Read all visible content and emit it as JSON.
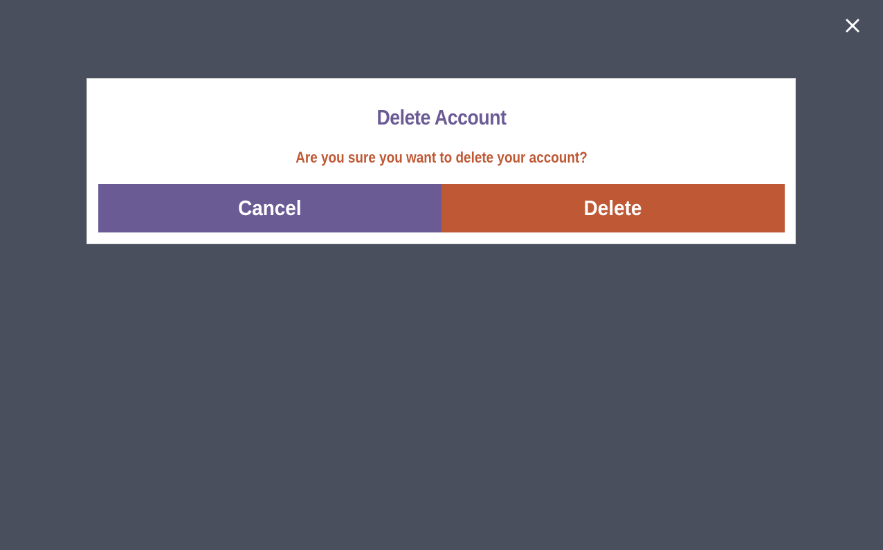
{
  "window": {
    "close_icon": "close-icon"
  },
  "dialog": {
    "title": "Delete Account",
    "message": "Are you sure you want to delete your account?",
    "cancel_label": "Cancel",
    "delete_label": "Delete"
  },
  "colors": {
    "background": "#4a4f5e",
    "primary": "#6b5b95",
    "danger": "#bf5834",
    "surface": "#ffffff"
  }
}
